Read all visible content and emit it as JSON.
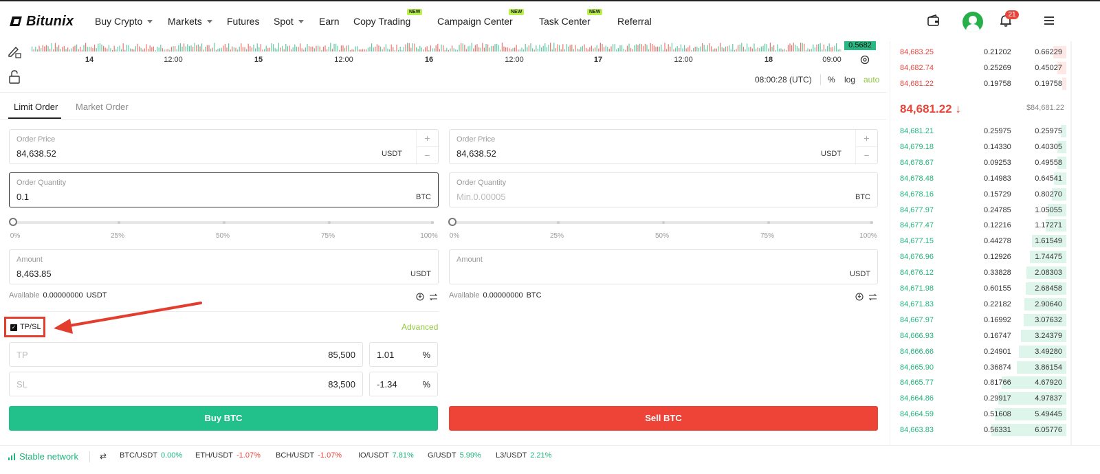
{
  "header": {
    "logo": "Bitunix",
    "nav": [
      {
        "label": "Buy Crypto",
        "caret": true
      },
      {
        "label": "Markets",
        "caret": true
      },
      {
        "label": "Futures",
        "caret": false
      },
      {
        "label": "Spot",
        "caret": true
      },
      {
        "label": "Earn",
        "caret": false
      },
      {
        "label": "Copy Trading",
        "caret": false,
        "badge": "NEW"
      },
      {
        "label": "Campaign Center",
        "caret": false,
        "badge": "NEW"
      },
      {
        "label": "Task Center",
        "caret": false,
        "badge": "NEW"
      },
      {
        "label": "Referral",
        "caret": false
      }
    ],
    "notification_count": "21"
  },
  "chart": {
    "volume_tag": "0.5682",
    "ticks": [
      {
        "label": "14",
        "bold": true
      },
      {
        "label": "12:00",
        "bold": false
      },
      {
        "label": "15",
        "bold": true
      },
      {
        "label": "12:00",
        "bold": false
      },
      {
        "label": "16",
        "bold": true
      },
      {
        "label": "12:00",
        "bold": false
      },
      {
        "label": "17",
        "bold": true
      },
      {
        "label": "12:00",
        "bold": false
      },
      {
        "label": "18",
        "bold": true
      },
      {
        "label": "09:00",
        "bold": false
      }
    ],
    "clock": "08:00:28 (UTC)",
    "percent_label": "%",
    "log_label": "log",
    "auto_label": "auto",
    "colors": {
      "up": "#2bb784",
      "down": "#e8463b"
    }
  },
  "order_tabs": {
    "limit": "Limit Order",
    "market": "Market Order"
  },
  "buy": {
    "price_label": "Order Price",
    "price_value": "84,638.52",
    "price_unit": "USDT",
    "qty_label": "Order Quantity",
    "qty_value": "0.1",
    "qty_unit": "BTC",
    "pcts": [
      "0%",
      "25%",
      "50%",
      "75%",
      "100%"
    ],
    "amount_label": "Amount",
    "amount_value": "8,463.85",
    "amount_unit": "USDT",
    "available_label": "Available",
    "available_value": "0.00000000",
    "available_unit": "USDT",
    "tpsl_label": "TP/SL",
    "advanced_label": "Advanced",
    "tp_placeholder": "TP",
    "tp_value": "85,500",
    "tp_pct": "1.01",
    "sl_placeholder": "SL",
    "sl_value": "83,500",
    "sl_pct": "-1.34",
    "pct_sign": "%",
    "button": "Buy BTC"
  },
  "sell": {
    "price_label": "Order Price",
    "price_value": "84,638.52",
    "price_unit": "USDT",
    "qty_label": "Order Quantity",
    "qty_placeholder": "Min.0.00005",
    "qty_unit": "BTC",
    "pcts": [
      "0%",
      "25%",
      "50%",
      "75%",
      "100%"
    ],
    "amount_label": "Amount",
    "amount_unit": "USDT",
    "available_label": "Available",
    "available_value": "0.00000000",
    "available_unit": "BTC",
    "button": "Sell BTC"
  },
  "orderbook": {
    "asks": [
      {
        "price": "84,683.25",
        "qty": "0.21202",
        "total": "0.66229",
        "depth": 0.12
      },
      {
        "price": "84,682.74",
        "qty": "0.25269",
        "total": "0.45027",
        "depth": 0.08
      },
      {
        "price": "84,681.22",
        "qty": "0.19758",
        "total": "0.19758",
        "depth": 0.04
      }
    ],
    "mid_price": "84,681.22",
    "mid_arrow": "↓",
    "mid_usd": "$84,681.22",
    "bids": [
      {
        "price": "84,681.21",
        "qty": "0.25975",
        "total": "0.25975",
        "depth": 0.05
      },
      {
        "price": "84,679.18",
        "qty": "0.14330",
        "total": "0.40305",
        "depth": 0.08
      },
      {
        "price": "84,678.67",
        "qty": "0.09253",
        "total": "0.49558",
        "depth": 0.08
      },
      {
        "price": "84,678.48",
        "qty": "0.14983",
        "total": "0.64541",
        "depth": 0.11
      },
      {
        "price": "84,678.16",
        "qty": "0.15729",
        "total": "0.80270",
        "depth": 0.13
      },
      {
        "price": "84,677.97",
        "qty": "0.24785",
        "total": "1.05055",
        "depth": 0.17
      },
      {
        "price": "84,677.47",
        "qty": "0.12216",
        "total": "1.17271",
        "depth": 0.19
      },
      {
        "price": "84,677.15",
        "qty": "0.44278",
        "total": "1.61549",
        "depth": 0.31
      },
      {
        "price": "84,676.96",
        "qty": "0.12926",
        "total": "1.74475",
        "depth": 0.33
      },
      {
        "price": "84,676.12",
        "qty": "0.33828",
        "total": "2.08303",
        "depth": 0.36
      },
      {
        "price": "84,671.98",
        "qty": "0.60155",
        "total": "2.68458",
        "depth": 0.37
      },
      {
        "price": "84,671.83",
        "qty": "0.22182",
        "total": "2.90640",
        "depth": 0.38
      },
      {
        "price": "84,667.97",
        "qty": "0.16992",
        "total": "3.07632",
        "depth": 0.39
      },
      {
        "price": "84,666.93",
        "qty": "0.16747",
        "total": "3.24379",
        "depth": 0.41
      },
      {
        "price": "84,666.66",
        "qty": "0.24901",
        "total": "3.49280",
        "depth": 0.43
      },
      {
        "price": "84,665.90",
        "qty": "0.36874",
        "total": "3.86154",
        "depth": 0.45
      },
      {
        "price": "84,665.77",
        "qty": "0.81766",
        "total": "4.67920",
        "depth": 0.59
      },
      {
        "price": "84,664.86",
        "qty": "0.29917",
        "total": "4.97837",
        "depth": 0.62
      },
      {
        "price": "84,664.59",
        "qty": "0.51608",
        "total": "5.49445",
        "depth": 0.65
      },
      {
        "price": "84,663.83",
        "qty": "0.56331",
        "total": "6.05776",
        "depth": 0.68
      }
    ]
  },
  "footer": {
    "network": "Stable network",
    "tickers": [
      {
        "symbol": "BTC/USDT",
        "change": "0.00%",
        "dir": "up"
      },
      {
        "symbol": "ETH/USDT",
        "change": "-1.07%",
        "dir": "down"
      },
      {
        "symbol": "BCH/USDT",
        "change": "-1.07%",
        "dir": "down"
      },
      {
        "symbol": "IO/USDT",
        "change": "7.81%",
        "dir": "up"
      },
      {
        "symbol": "G/USDT",
        "change": "5.99%",
        "dir": "up"
      },
      {
        "symbol": "L3/USDT",
        "change": "2.21%",
        "dir": "up"
      }
    ]
  }
}
